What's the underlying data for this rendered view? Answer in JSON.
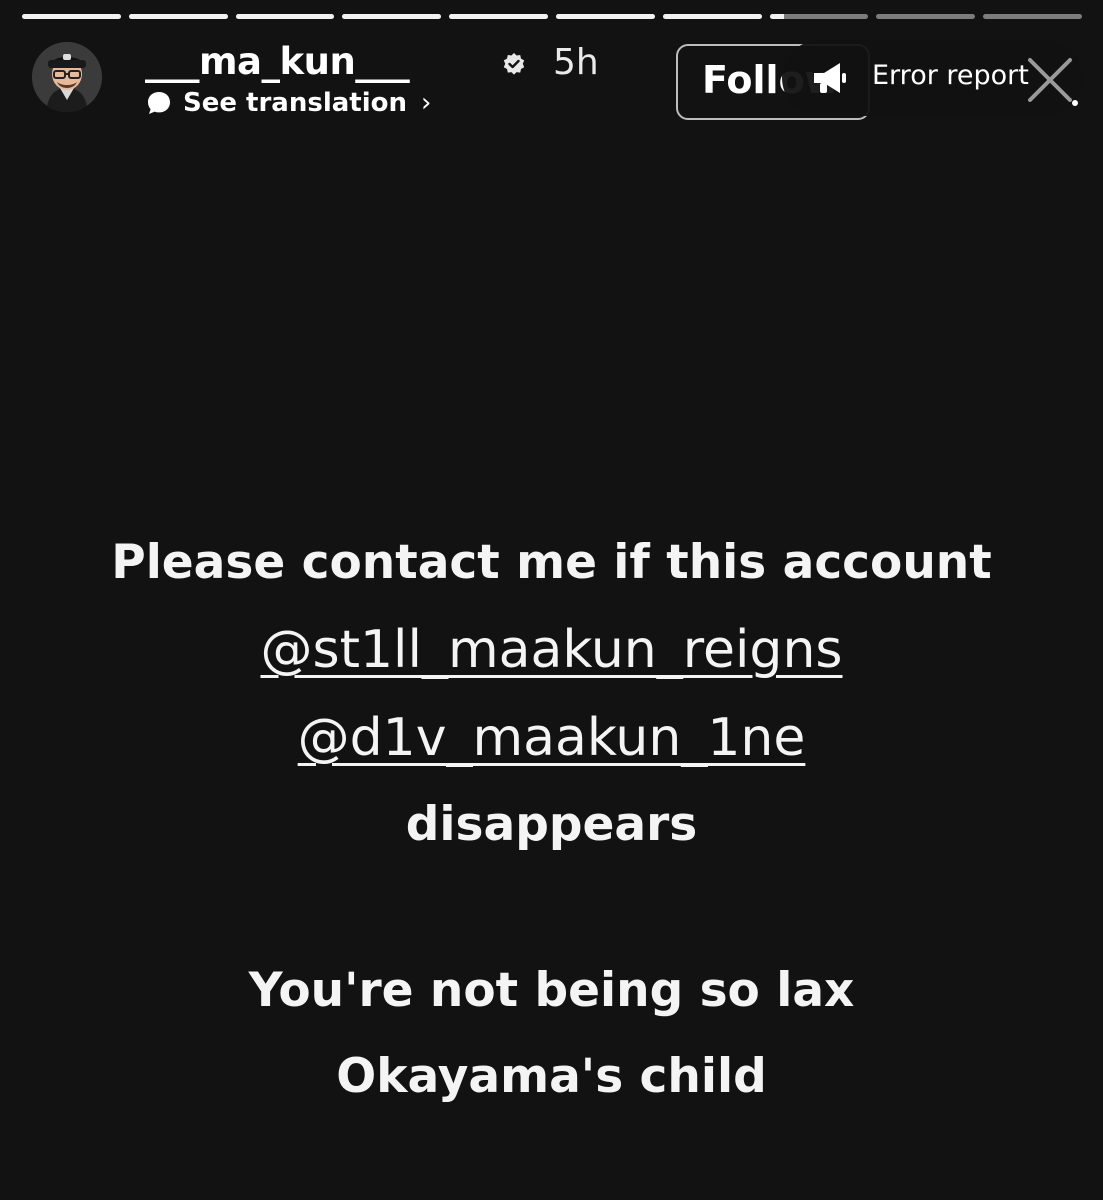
{
  "story": {
    "progress_segments": [
      1,
      1,
      1,
      1,
      1,
      1,
      1,
      0.15,
      0,
      0
    ],
    "header": {
      "username": "___ma_kun___",
      "verified_icon": "verified-badge-icon",
      "time": "5h",
      "translation_label": "See translation",
      "translation_chevron": "›",
      "follow_label": "Follow",
      "error_report_label": "Error report",
      "error_report_icon": "megaphone-icon",
      "close_icon": "close-icon"
    },
    "body": {
      "line1": "Please contact me if this account",
      "handle1": "@st1ll_maakun_reigns",
      "handle2": "@d1v_maakun_1ne",
      "line4": "disappears",
      "line5": "You're not being so lax",
      "line6": "Okayama's child"
    }
  }
}
